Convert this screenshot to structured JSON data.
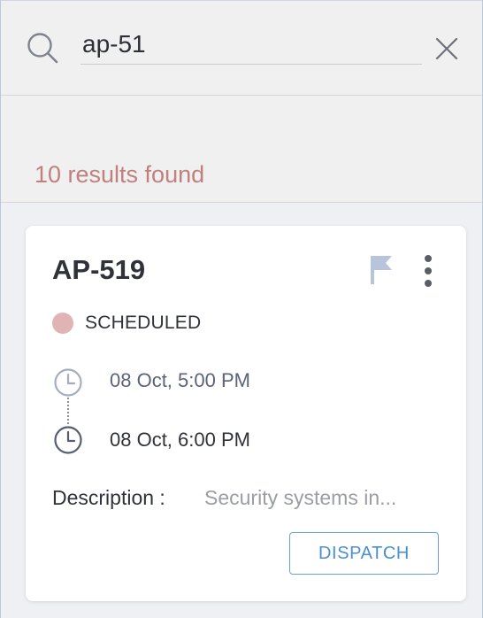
{
  "search": {
    "query": "ap-51",
    "icon": "search-icon",
    "clear_icon": "close-icon"
  },
  "results": {
    "count_text": "10 results found"
  },
  "card": {
    "title": "AP-519",
    "flag_icon": "flag-icon",
    "more_icon": "more-vertical-icon",
    "status": {
      "label": "SCHEDULED",
      "color": "#e0b4b4"
    },
    "start_time": "08 Oct, 5:00 PM",
    "end_time": "08 Oct, 6:00 PM",
    "description_label": "Description :",
    "description_value": "Security systems in...",
    "dispatch_label": "DISPATCH"
  },
  "colors": {
    "accent": "#4a8fd2",
    "results_text": "#c0807e",
    "flag": "#b7c4dc"
  }
}
